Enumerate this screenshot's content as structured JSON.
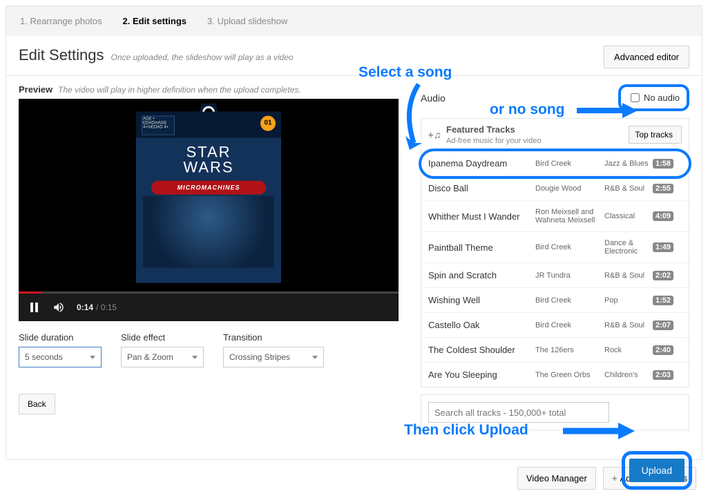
{
  "steps": [
    "1. Rearrange photos",
    "2. Edit settings",
    "3. Upload slideshow"
  ],
  "active_step": 1,
  "title": "Edit Settings",
  "title_hint": "Once uploaded, the slideshow will play as a video",
  "advanced_btn": "Advanced editor",
  "preview_label": "Preview",
  "preview_hint": "The video will play in higher definition when the upload completes.",
  "video": {
    "current": "0:14",
    "duration": "0:15",
    "product_badge": "01",
    "age_text": "AGE • EDAD\\nAGE 4+\\nEDAD 4+",
    "logo1": "STAR",
    "logo2": "WARS",
    "band": "MICROMACHINES"
  },
  "opts": {
    "slide_duration": {
      "label": "Slide duration",
      "value": "5 seconds"
    },
    "slide_effect": {
      "label": "Slide effect",
      "value": "Pan & Zoom"
    },
    "transition": {
      "label": "Transition",
      "value": "Crossing Stripes"
    }
  },
  "back_btn": "Back",
  "audio": {
    "label": "Audio",
    "no_audio": "No audio",
    "featured": "Featured Tracks",
    "featured_sub": "Ad-free music for your video",
    "top_tracks_btn": "Top tracks",
    "search_placeholder": "Search all tracks - 150,000+ total",
    "tracks": [
      {
        "title": "Ipanema Daydream",
        "artist": "Bird Creek",
        "genre": "Jazz & Blues",
        "dur": "1:58",
        "selected": true
      },
      {
        "title": "Disco Ball",
        "artist": "Dougie Wood",
        "genre": "R&B & Soul",
        "dur": "2:55"
      },
      {
        "title": "Whither Must I Wander",
        "artist": "Ron Meixsell and Wahneta Meixsell",
        "genre": "Classical",
        "dur": "4:09"
      },
      {
        "title": "Paintball Theme",
        "artist": "Bird Creek",
        "genre": "Dance & Electronic",
        "dur": "1:49"
      },
      {
        "title": "Spin and Scratch",
        "artist": "JR Tundra",
        "genre": "R&B & Soul",
        "dur": "2:02"
      },
      {
        "title": "Wishing Well",
        "artist": "Bird Creek",
        "genre": "Pop",
        "dur": "1:52"
      },
      {
        "title": "Castello Oak",
        "artist": "Bird Creek",
        "genre": "R&B & Soul",
        "dur": "2:07"
      },
      {
        "title": "The Coldest Shoulder",
        "artist": "The 126ers",
        "genre": "Rock",
        "dur": "2:40"
      },
      {
        "title": "Are You Sleeping",
        "artist": "The Green Orbs",
        "genre": "Children's",
        "dur": "2:03"
      }
    ]
  },
  "upload_btn": "Upload",
  "video_manager_btn": "Video Manager",
  "add_more_btn": "Add more videos",
  "annotations": {
    "select_song": "Select a song",
    "or_no_song": "or no song",
    "then_upload": "Then click Upload"
  }
}
